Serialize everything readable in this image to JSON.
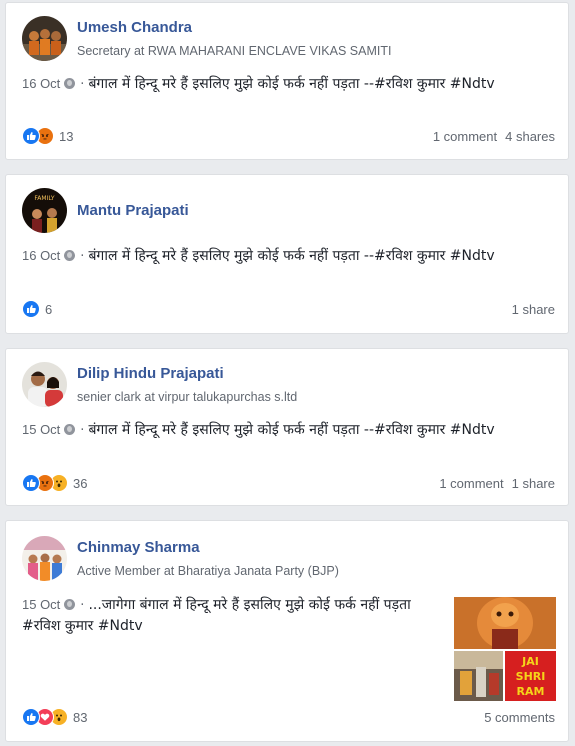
{
  "posts": [
    {
      "author": "Umesh Chandra",
      "subtitle": "Secretary at RWA MAHARANI ENCLAVE VIKAS SAMITI",
      "date": "16 Oct",
      "separator": "·",
      "text": "बंगाल में हिन्दू मरे हैं इसलिए मुझे कोई फर्क नहीं पड़ता --#रविश कुमार #Ndtv",
      "reaction_icons": [
        "like-icon",
        "angry-icon"
      ],
      "reaction_count": "13",
      "comments": "1 comment",
      "shares": "4 shares"
    },
    {
      "author": "Mantu Prajapati",
      "subtitle": "",
      "date": "16 Oct",
      "separator": "·",
      "text": "बंगाल में हिन्दू मरे हैं इसलिए मुझे कोई फर्क नहीं पड़ता --#रविश कुमार #Ndtv",
      "reaction_icons": [
        "like-icon"
      ],
      "reaction_count": "6",
      "comments": "",
      "shares": "1 share",
      "avatar_text": "FAMILY"
    },
    {
      "author": "Dilip Hindu Prajapati",
      "subtitle": "senier clark at virpur talukapurchas s.ltd",
      "date": "15 Oct",
      "separator": "·",
      "text": "बंगाल में हिन्दू मरे हैं इसलिए मुझे कोई फर्क नहीं पड़ता --#रविश कुमार #Ndtv",
      "reaction_icons": [
        "like-icon",
        "angry-icon",
        "wow-icon"
      ],
      "reaction_count": "36",
      "comments": "1 comment",
      "shares": "1 share"
    },
    {
      "author": "Chinmay Sharma",
      "subtitle": "Active Member at Bharatiya Janata Party (BJP)",
      "date": "15 Oct",
      "separator": "·",
      "text": "...जागेगा बंगाल में हिन्दू मरे हैं इसलिए मुझे कोई फर्क नहीं पड़ता #रविश कुमार #Ndtv",
      "reaction_icons": [
        "like-icon",
        "love-icon",
        "wow-icon"
      ],
      "reaction_count": "83",
      "comments": "5 comments",
      "shares": "",
      "photo_text": [
        "JAI",
        "SHRI",
        "RAM"
      ]
    }
  ],
  "colors": {
    "name_link": "#385898",
    "meta": "#616770",
    "like": "#1877f2",
    "angry": "#e9710f",
    "love": "#f33e58",
    "wow": "#f7b125"
  }
}
